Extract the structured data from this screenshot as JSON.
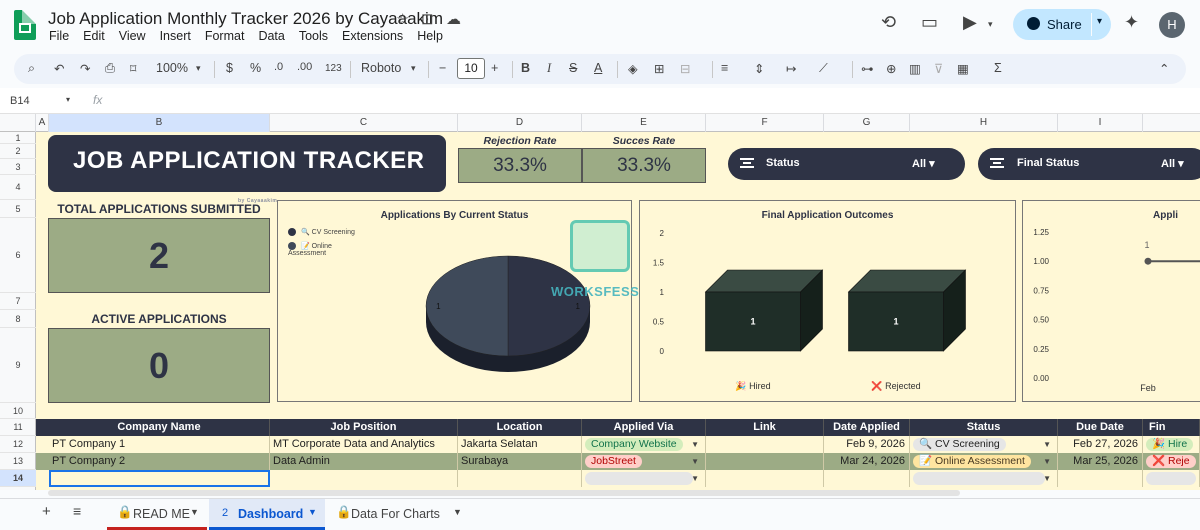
{
  "app": {
    "doc_title": "Job Application Monthly Tracker 2026 by Cayaaakim",
    "menu": [
      "File",
      "Edit",
      "View",
      "Insert",
      "Format",
      "Data",
      "Tools",
      "Extensions",
      "Help"
    ],
    "share_label": "Share",
    "avatar_letter": "H"
  },
  "toolbar": {
    "zoom": "100%",
    "currency": "$",
    "percent": "%",
    "dec_dec": ".0",
    "dec_inc": ".00",
    "format_num": "123",
    "font": "Roboto",
    "font_size": "10"
  },
  "formula_bar": {
    "cell_ref": "B14",
    "fx": "fx",
    "value": ""
  },
  "columns": [
    "A",
    "B",
    "C",
    "D",
    "E",
    "F",
    "G",
    "H",
    "I"
  ],
  "rows": [
    "1",
    "2",
    "3",
    "4",
    "5",
    "6",
    "7",
    "8",
    "9",
    "10",
    "11",
    "12",
    "13",
    "14"
  ],
  "dashboard": {
    "title": "JOB APPLICATION TRACKER",
    "byline": "by Cayaaakim",
    "rejection_label": "Rejection Rate",
    "rejection_value": "33.3%",
    "success_label": "Succes Rate",
    "success_value": "33.3%",
    "filter1_label": "Status",
    "filter1_value": "All ▾",
    "filter2_label": "Final Status",
    "filter2_value": "All ▾",
    "total_label": "TOTAL APPLICATIONS SUBMITTED",
    "total_value": "2",
    "active_label": "ACTIVE APPLICATIONS",
    "active_value": "0",
    "watermark": "WORKSFESS"
  },
  "chart_data": [
    {
      "type": "pie",
      "title": "Applications By Current Status",
      "categories": [
        "🔍 CV Screening",
        "📝 Online Assessment"
      ],
      "values": [
        1,
        1
      ],
      "colors": [
        "#2e3345",
        "#3f4a5a"
      ]
    },
    {
      "type": "bar",
      "title": "Final Application Outcomes",
      "categories": [
        "🎉 Hired",
        "❌ Rejected"
      ],
      "values": [
        1,
        1
      ],
      "ylim": [
        0,
        2
      ],
      "yticks": [
        "2",
        "1.5",
        "1",
        "0.5",
        "0"
      ],
      "color": "#1f2e28"
    },
    {
      "type": "line",
      "title": "Appli",
      "categories": [
        "Feb"
      ],
      "values": [
        1
      ],
      "ylim": [
        0,
        1.25
      ],
      "yticks": [
        "1.25",
        "1.00",
        "0.75",
        "0.50",
        "0.25",
        "0.00"
      ],
      "data_label": "1"
    }
  ],
  "table": {
    "headers": [
      "Company Name",
      "Job Position",
      "Location",
      "Applied Via",
      "Link",
      "Date Applied",
      "Status",
      "Due Date",
      "Fin"
    ],
    "rows": [
      {
        "company": "PT Company 1",
        "position": "MT Corporate Data and Analytics",
        "location": "Jakarta Selatan",
        "via": "Company Website",
        "link": "",
        "date": "Feb 9, 2026",
        "status": "🔍 CV Screening",
        "due": "Feb 27, 2026",
        "final": "🎉 Hire"
      },
      {
        "company": "PT Company 2",
        "position": "Data Admin",
        "location": "Surabaya",
        "via": "JobStreet",
        "link": "",
        "date": "Mar 24, 2026",
        "status": "📝 Online Assessment",
        "due": "Mar 25, 2026",
        "final": "❌ Reje"
      }
    ]
  },
  "tabs": [
    {
      "label": "READ ME"
    },
    {
      "label": "Dashboard",
      "index": "2"
    },
    {
      "label": "Data For Charts"
    }
  ]
}
